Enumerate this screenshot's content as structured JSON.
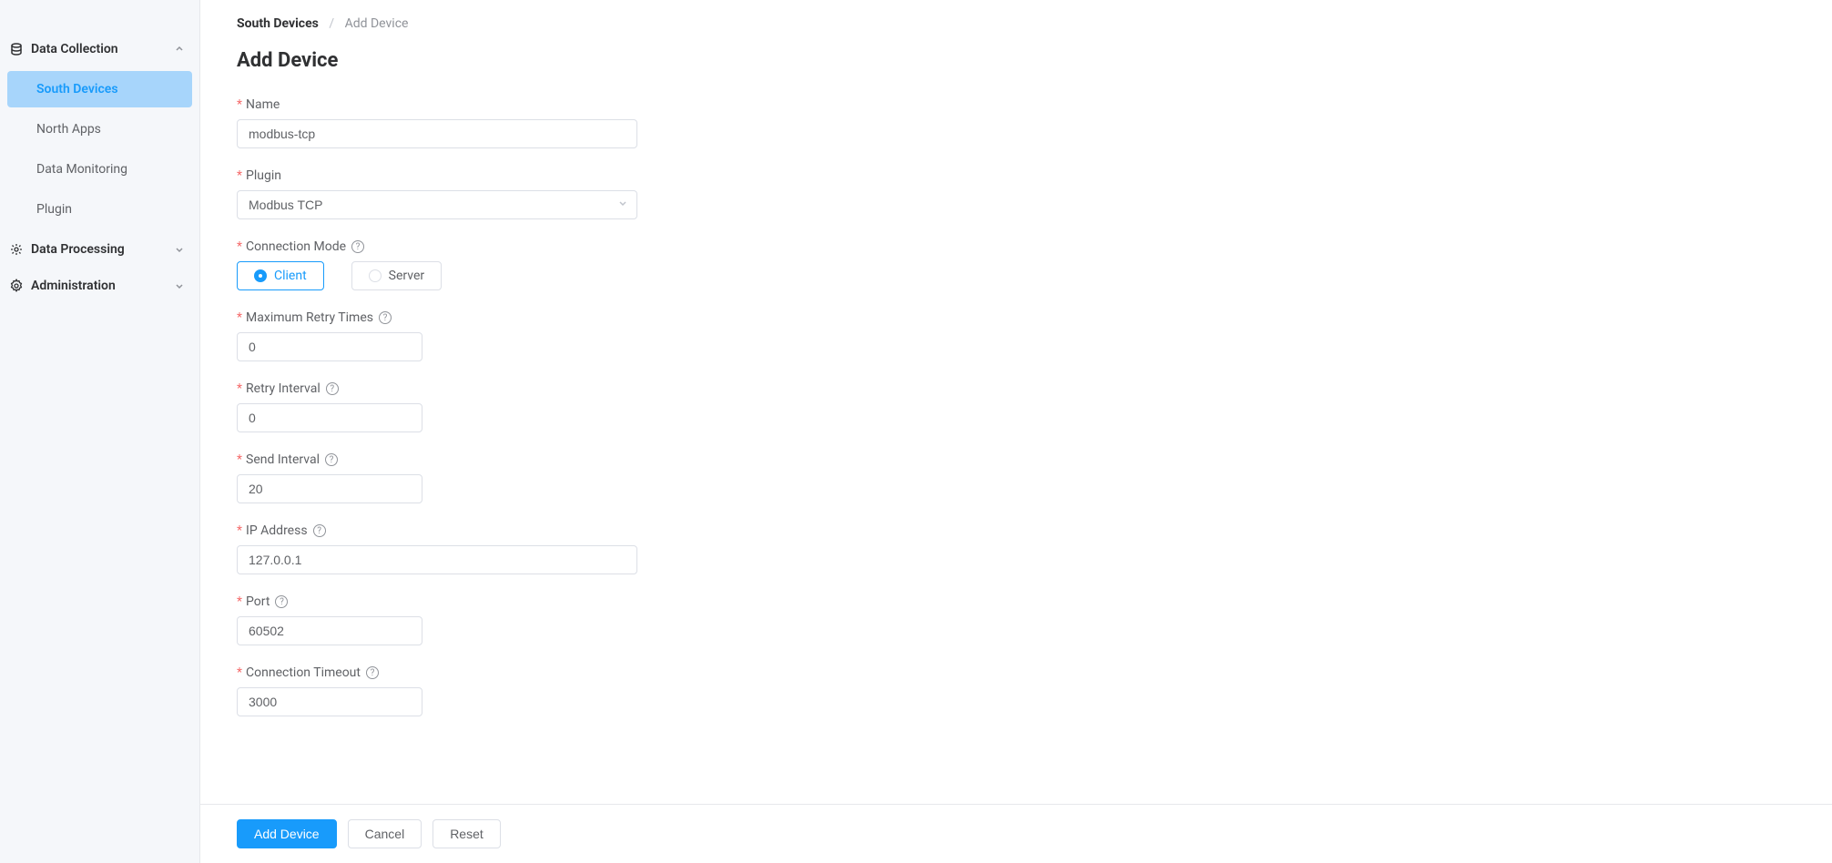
{
  "sidebar": {
    "groups": [
      {
        "label": "Data Collection",
        "expanded": true,
        "items": [
          "South Devices",
          "North Apps",
          "Data Monitoring",
          "Plugin"
        ],
        "active_index": 0
      },
      {
        "label": "Data Processing",
        "expanded": false
      },
      {
        "label": "Administration",
        "expanded": false
      }
    ]
  },
  "breadcrumb": {
    "parent": "South Devices",
    "separator": "/",
    "current": "Add Device"
  },
  "page": {
    "title": "Add Device"
  },
  "form": {
    "name": {
      "label": "Name",
      "value": "modbus-tcp"
    },
    "plugin": {
      "label": "Plugin",
      "value": "Modbus TCP"
    },
    "connection_mode": {
      "label": "Connection Mode",
      "options": [
        "Client",
        "Server"
      ],
      "selected": 0
    },
    "max_retry": {
      "label": "Maximum Retry Times",
      "value": "0"
    },
    "retry_interval": {
      "label": "Retry Interval",
      "value": "0"
    },
    "send_interval": {
      "label": "Send Interval",
      "value": "20"
    },
    "ip_address": {
      "label": "IP Address",
      "value": "127.0.0.1"
    },
    "port": {
      "label": "Port",
      "value": "60502"
    },
    "connection_timeout": {
      "label": "Connection Timeout",
      "value": "3000"
    }
  },
  "footer": {
    "add": "Add Device",
    "cancel": "Cancel",
    "reset": "Reset"
  }
}
